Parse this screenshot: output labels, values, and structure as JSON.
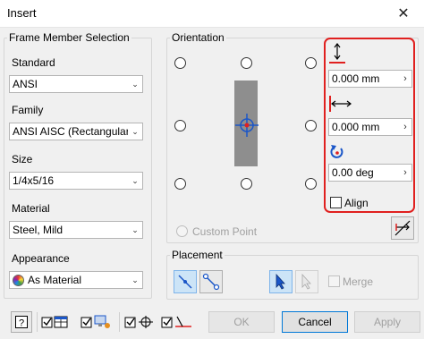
{
  "window": {
    "title": "Insert",
    "close_glyph": "✕"
  },
  "frame_member": {
    "group_title": "Frame Member Selection",
    "standard": {
      "label": "Standard",
      "value": "ANSI"
    },
    "family": {
      "label": "Family",
      "value": "ANSI AISC (Rectangular) -"
    },
    "size": {
      "label": "Size",
      "value": "1/4x5/16"
    },
    "material": {
      "label": "Material",
      "value": "Steel, Mild"
    },
    "appearance": {
      "label": "Appearance",
      "value": "As Material"
    }
  },
  "orientation": {
    "group_title": "Orientation",
    "custom_point_label": "Custom Point",
    "vertical_offset": "0.000 mm",
    "horizontal_offset": "0.000 mm",
    "rotation": "0.00 deg",
    "align_label": "Align",
    "spin_glyph": "›"
  },
  "placement": {
    "group_title": "Placement",
    "merge_label": "Merge"
  },
  "buttons": {
    "ok": "OK",
    "cancel": "Cancel",
    "apply": "Apply"
  },
  "colors": {
    "highlight": "#e0201f",
    "icon_blue": "#1a56c8",
    "selected_bg": "#cce4f7"
  }
}
